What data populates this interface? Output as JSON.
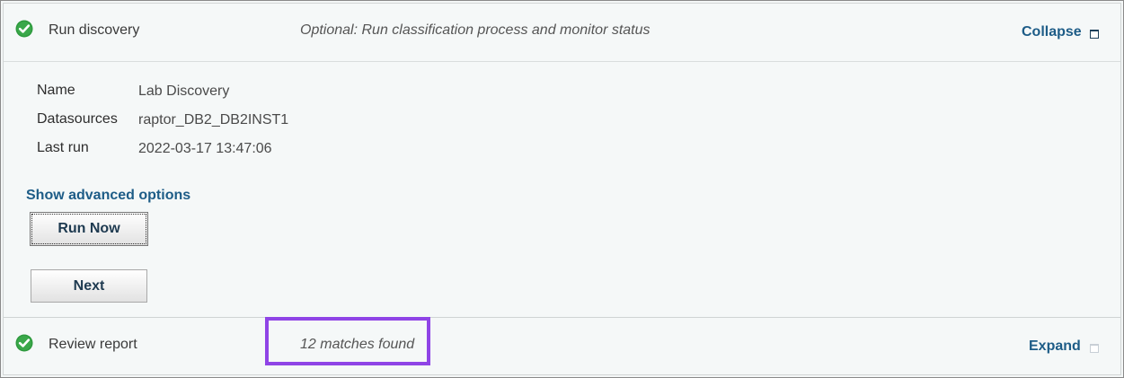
{
  "steps": {
    "run_discovery": {
      "title": "Run discovery",
      "description": "Optional: Run classification process and monitor status",
      "toggle_label": "Collapse",
      "status_icon": "check-icon",
      "details": [
        {
          "label": "Name",
          "value": "Lab Discovery"
        },
        {
          "label": "Datasources",
          "value": "raptor_DB2_DB2INST1"
        },
        {
          "label": "Last run",
          "value": "2022-03-17 13:47:06"
        }
      ],
      "advanced_link": "Show advanced options",
      "run_now_label": "Run Now",
      "next_label": "Next"
    },
    "review_report": {
      "title": "Review report",
      "description": "12 matches found",
      "toggle_label": "Expand",
      "status_icon": "check-icon"
    }
  },
  "colors": {
    "link": "#1d5c87",
    "check_green": "#2e9a3e",
    "highlight": "#8f44e6"
  }
}
